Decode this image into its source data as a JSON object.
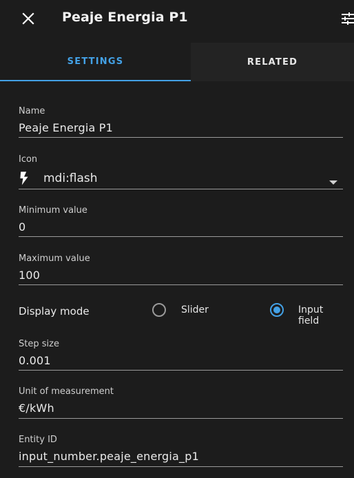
{
  "header": {
    "title": "Peaje Energia P1",
    "close_icon": "close-icon",
    "settings_icon": "tune-icon"
  },
  "tabs": [
    {
      "label": "Settings",
      "active": true
    },
    {
      "label": "Related",
      "active": false
    }
  ],
  "form": {
    "name": {
      "label": "Name",
      "value": "Peaje Energia P1"
    },
    "icon": {
      "label": "Icon",
      "value": "mdi:flash",
      "icon": "flash-icon"
    },
    "minimum": {
      "label": "Minimum value",
      "value": "0"
    },
    "maximum": {
      "label": "Maximum value",
      "value": "100"
    },
    "display_mode": {
      "label": "Display mode",
      "options": [
        {
          "label": "Slider",
          "selected": false
        },
        {
          "label": "Input field",
          "selected": true
        }
      ]
    },
    "step": {
      "label": "Step size",
      "value": "0.001"
    },
    "unit": {
      "label": "Unit of measurement",
      "value": "€/kWh"
    },
    "entity_id": {
      "label": "Entity ID",
      "value": "input_number.peaje_energia_p1"
    }
  },
  "colors": {
    "background": "#1c1c1c",
    "accent": "#43a1e6",
    "tab_inactive_bg": "#232323"
  }
}
